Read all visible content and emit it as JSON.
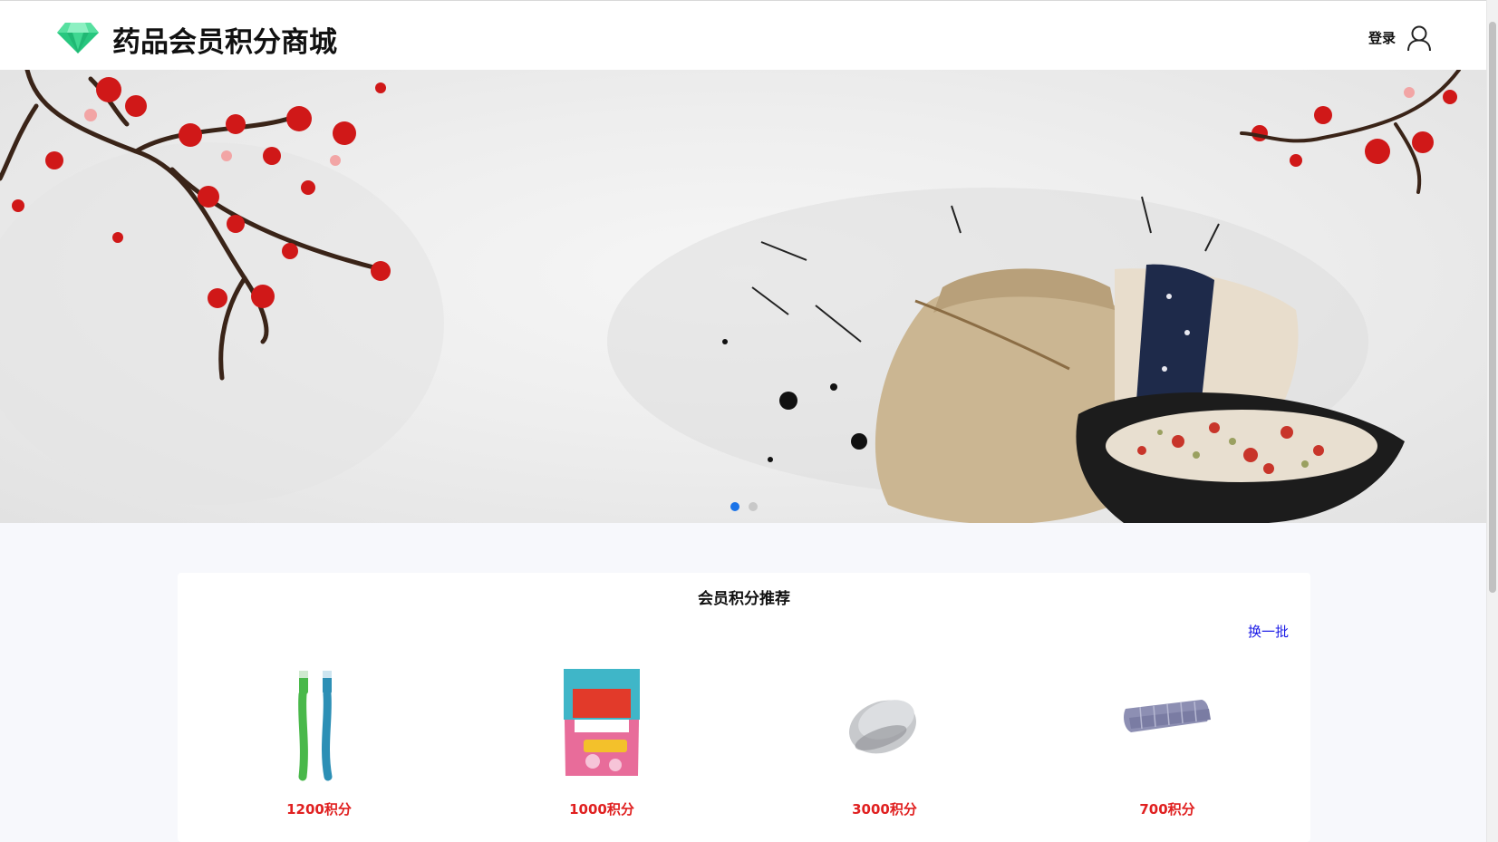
{
  "header": {
    "title": "药品会员积分商城",
    "login_label": "登录",
    "icons": {
      "logo": "diamond-logo-icon",
      "user": "user-icon"
    },
    "logo_color": "#2ecf86"
  },
  "banner": {
    "slides_count": 2,
    "active_slide": 1,
    "dot_active_color": "#1a73e8",
    "dot_inactive_color": "#c8c8c8"
  },
  "recommend": {
    "title": "会员积分推荐",
    "refresh_label": "换一批",
    "products": [
      {
        "name_icon": "toothbrush-image",
        "points": "1200积分"
      },
      {
        "name_icon": "detergent-bag-image",
        "points": "1000积分"
      },
      {
        "name_icon": "computer-mouse-image",
        "points": "3000积分"
      },
      {
        "name_icon": "towel-image",
        "points": "700积分"
      }
    ],
    "price_color": "#e02020"
  }
}
